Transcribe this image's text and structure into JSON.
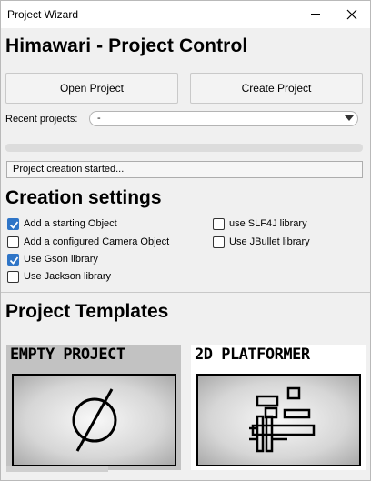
{
  "window": {
    "title": "Project Wizard"
  },
  "heading": "Himawari - Project Control",
  "buttons": {
    "open": "Open Project",
    "create": "Create Project"
  },
  "recent": {
    "label": "Recent projects:",
    "selected": "-"
  },
  "progress": {
    "value": 0
  },
  "status": "Project creation started...",
  "creation_settings": {
    "title": "Creation settings",
    "options": [
      {
        "label": "Add a starting Object",
        "checked": true
      },
      {
        "label": "Add a configured Camera Object",
        "checked": false
      },
      {
        "label": "Use Gson library",
        "checked": true
      },
      {
        "label": "Use Jackson library",
        "checked": false
      },
      {
        "label": "use SLF4J library",
        "checked": false
      },
      {
        "label": "Use JBullet library",
        "checked": false
      }
    ]
  },
  "templates": {
    "title": "Project Templates",
    "items": [
      {
        "label": "EMPTY PROJECT",
        "icon": "empty-set-icon"
      },
      {
        "label": "2D PLATFORMER",
        "icon": "platformer-blocks-icon"
      }
    ]
  },
  "colors": {
    "checkbox": "#2f75c7",
    "progress": "#06b025"
  }
}
